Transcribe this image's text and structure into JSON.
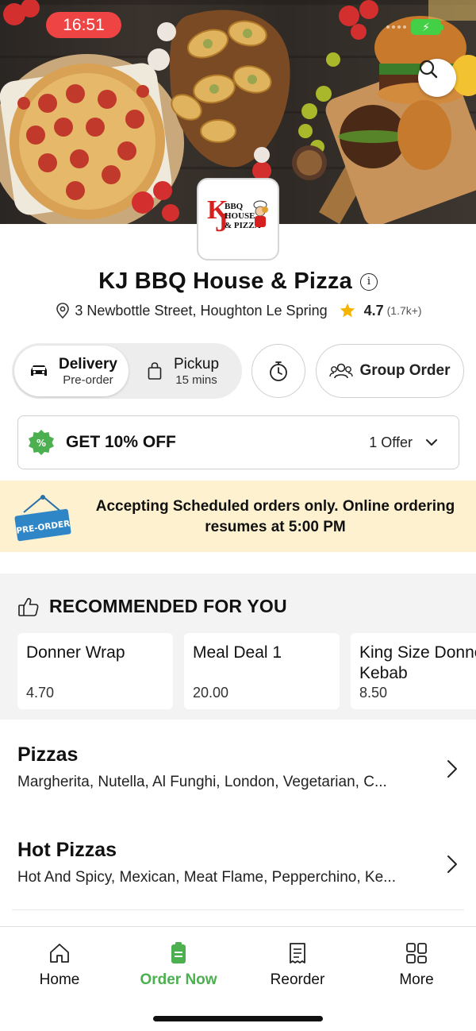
{
  "status_bar": {
    "time": "16:51"
  },
  "restaurant": {
    "name": "KJ BBQ House & Pizza",
    "address": "3 Newbottle Street, Houghton Le Spring",
    "rating": "4.7",
    "rating_count": "(1.7k+)",
    "logo": {
      "k": "K",
      "j": "J",
      "line1": "BBQ",
      "line2": "HOUSE",
      "line3": "& PIZZA"
    }
  },
  "order_mode": {
    "delivery": {
      "label": "Delivery",
      "sub": "Pre-order"
    },
    "pickup": {
      "label": "Pickup",
      "sub": "15 mins"
    },
    "group_order_label": "Group Order"
  },
  "offer": {
    "title": "GET 10% OFF",
    "count": "1 Offer"
  },
  "banner": {
    "sign_text": "PRE-ORDER",
    "message": "Accepting Scheduled orders only. Online ordering resumes at 5:00 PM"
  },
  "recommended": {
    "heading": "RECOMMENDED FOR YOU",
    "items": [
      {
        "name": "Donner Wrap",
        "price": "4.70"
      },
      {
        "name": "Meal Deal 1",
        "price": "20.00"
      },
      {
        "name": "King Size Donner Kebab",
        "price": "8.50"
      }
    ]
  },
  "categories": [
    {
      "title": "Pizzas",
      "items": "Margherita, Nutella, Al Funghi, London, Vegetarian, C..."
    },
    {
      "title": "Hot Pizzas",
      "items": "Hot And Spicy, Mexican, Meat Flame, Pepperchino, Ke..."
    }
  ],
  "tabbar": {
    "items": [
      {
        "label": "Home",
        "icon": "home-icon"
      },
      {
        "label": "Order Now",
        "icon": "order-icon"
      },
      {
        "label": "Reorder",
        "icon": "receipt-icon"
      },
      {
        "label": "More",
        "icon": "grid-icon"
      }
    ],
    "active_color": "#4caf50"
  },
  "colors": {
    "accent_green": "#4caf50",
    "banner_bg": "#fdf1cf",
    "status_pill": "#ee4444"
  }
}
